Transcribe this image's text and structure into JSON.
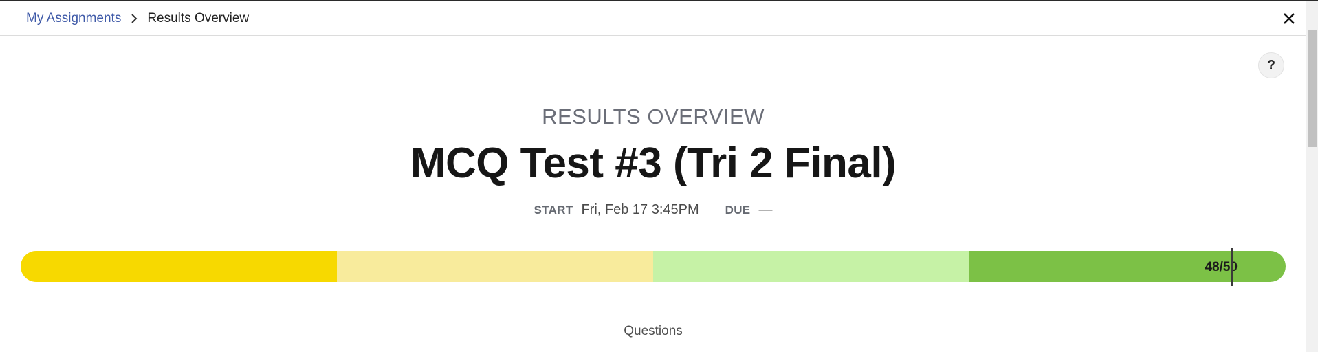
{
  "breadcrumb": {
    "parent_label": "My Assignments",
    "current_label": "Results Overview"
  },
  "header": {
    "close_icon": "close-icon"
  },
  "help": {
    "label": "?"
  },
  "page": {
    "overview_label": "RESULTS OVERVIEW",
    "title": "MCQ Test #3 (Tri 2 Final)",
    "start_key": "START",
    "start_value": "Fri, Feb 17 3:45PM",
    "due_key": "DUE",
    "due_value": "—"
  },
  "score": {
    "label": "48/50",
    "earned": 48,
    "total": 50,
    "segment_colors": [
      "#f7d900",
      "#f8eb9c",
      "#c6f2a6",
      "#7cc146"
    ]
  },
  "sections": {
    "questions_label": "Questions"
  }
}
